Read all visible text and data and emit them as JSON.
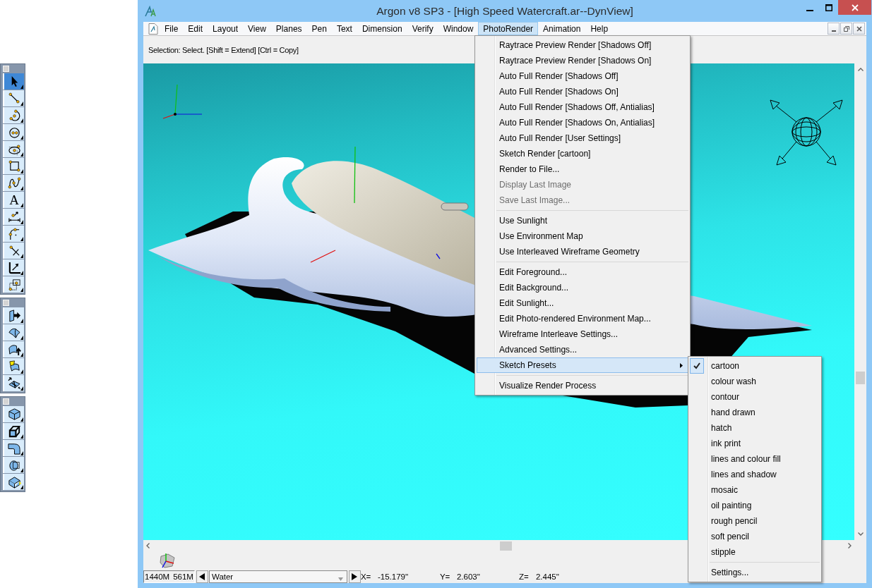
{
  "window": {
    "title": "Argon v8 SP3 - [High Speed Watercraft.ar--DynView]"
  },
  "toolbox": {
    "palettes": [
      {
        "tools": [
          {
            "selected": true
          },
          {
            "selected": false
          },
          {
            "selected": false
          },
          {
            "selected": false
          },
          {
            "selected": false
          },
          {
            "selected": false
          },
          {
            "selected": false
          },
          {
            "selected": false,
            "glyph": "A"
          },
          {
            "selected": false
          },
          {
            "selected": false
          },
          {
            "selected": false
          },
          {
            "selected": false
          },
          {
            "selected": false
          }
        ]
      },
      {
        "tools": [
          {
            "selected": false
          },
          {
            "selected": false
          },
          {
            "selected": false
          },
          {
            "selected": false
          },
          {
            "selected": false
          }
        ]
      },
      {
        "tools": [
          {
            "selected": false
          },
          {
            "selected": false
          },
          {
            "selected": false
          },
          {
            "selected": false
          },
          {
            "selected": false
          }
        ]
      }
    ]
  },
  "menu_bar": {
    "items": [
      {
        "label": "File",
        "selected": false
      },
      {
        "label": "Edit",
        "selected": false
      },
      {
        "label": "Layout",
        "selected": false
      },
      {
        "label": "View",
        "selected": false
      },
      {
        "label": "Planes",
        "selected": false
      },
      {
        "label": "Pen",
        "selected": false
      },
      {
        "label": "Text",
        "selected": false
      },
      {
        "label": "Dimension",
        "selected": false
      },
      {
        "label": "Verify",
        "selected": false
      },
      {
        "label": "Window",
        "selected": false
      },
      {
        "label": "PhotoRender",
        "selected": true
      },
      {
        "label": "Animation",
        "selected": false
      },
      {
        "label": "Help",
        "selected": false
      }
    ]
  },
  "prompt": "Selection: Select. [Shift = Extend] [Ctrl = Copy]",
  "photo_render_menu": {
    "groups": [
      {
        "items": [
          {
            "label": "Raytrace Preview Render [Shadows Off]",
            "kind": "command",
            "disabled": false,
            "selected": false
          },
          {
            "label": "Raytrace Preview Render [Shadows On]",
            "kind": "command",
            "disabled": false,
            "selected": false
          },
          {
            "label": "Auto Full Render [Shadows Off]",
            "kind": "command",
            "disabled": false,
            "selected": false
          },
          {
            "label": "Auto Full Render [Shadows On]",
            "kind": "command",
            "disabled": false,
            "selected": false
          },
          {
            "label": "Auto Full Render [Shadows Off, Antialias]",
            "kind": "command",
            "disabled": false,
            "selected": false
          },
          {
            "label": "Auto Full Render [Shadows On, Antialias]",
            "kind": "command",
            "disabled": false,
            "selected": false
          },
          {
            "label": "Auto Full Render [User Settings]",
            "kind": "command",
            "disabled": false,
            "selected": false
          },
          {
            "label": "Sketch Render [cartoon]",
            "kind": "command",
            "disabled": false,
            "selected": false
          },
          {
            "label": "Render to File...",
            "kind": "command",
            "disabled": false,
            "selected": false
          },
          {
            "label": "Display Last Image",
            "kind": "command",
            "disabled": true,
            "selected": false
          },
          {
            "label": "Save Last Image...",
            "kind": "command",
            "disabled": true,
            "selected": false
          }
        ]
      },
      {
        "items": [
          {
            "label": "Use Sunlight",
            "kind": "command",
            "disabled": false,
            "selected": false
          },
          {
            "label": "Use Environment Map",
            "kind": "command",
            "disabled": false,
            "selected": false
          },
          {
            "label": "Use Interleaved Wireframe Geometry",
            "kind": "command",
            "disabled": false,
            "selected": false
          }
        ]
      },
      {
        "items": [
          {
            "label": "Edit Foreground...",
            "kind": "command",
            "disabled": false,
            "selected": false
          },
          {
            "label": "Edit Background...",
            "kind": "command",
            "disabled": false,
            "selected": false
          },
          {
            "label": "Edit Sunlight...",
            "kind": "command",
            "disabled": false,
            "selected": false
          },
          {
            "label": "Edit Photo-rendered Environment Map...",
            "kind": "command",
            "disabled": false,
            "selected": false
          },
          {
            "label": "Wireframe Interleave Settings...",
            "kind": "command",
            "disabled": false,
            "selected": false
          },
          {
            "label": "Advanced Settings...",
            "kind": "command",
            "disabled": false,
            "selected": false
          },
          {
            "label": "Sketch Presets",
            "kind": "submenu",
            "disabled": false,
            "selected": true
          }
        ]
      },
      {
        "items": [
          {
            "label": "Visualize Render Process",
            "kind": "command",
            "disabled": false,
            "selected": false
          }
        ]
      }
    ]
  },
  "sketch_presets_submenu": {
    "groups": [
      {
        "items": [
          {
            "label": "cartoon",
            "checked": true,
            "selected": false
          },
          {
            "label": "colour wash",
            "checked": false,
            "selected": false
          },
          {
            "label": "contour",
            "checked": false,
            "selected": false
          },
          {
            "label": "hand drawn",
            "checked": false,
            "selected": false
          },
          {
            "label": "hatch",
            "checked": false,
            "selected": false
          },
          {
            "label": "ink print",
            "checked": false,
            "selected": false
          },
          {
            "label": "lines and colour fill",
            "checked": false,
            "selected": false
          },
          {
            "label": "lines and shadow",
            "checked": false,
            "selected": false
          },
          {
            "label": "mosaic",
            "checked": false,
            "selected": false
          },
          {
            "label": "oil painting",
            "checked": false,
            "selected": false
          },
          {
            "label": "rough pencil",
            "checked": false,
            "selected": false
          },
          {
            "label": "soft pencil",
            "checked": false,
            "selected": false
          },
          {
            "label": "stipple",
            "checked": false,
            "selected": false
          }
        ]
      },
      {
        "items": [
          {
            "label": "Settings...",
            "checked": false,
            "selected": false
          }
        ]
      }
    ]
  },
  "status_bar": {
    "memory": [
      "1440M",
      "561M"
    ],
    "layer": "Water",
    "coordinates": [
      {
        "label": "X=",
        "value": "-15.179\""
      },
      {
        "label": "Y=",
        "value": "2.603\""
      },
      {
        "label": "Z=",
        "value": "2.445\""
      }
    ]
  }
}
